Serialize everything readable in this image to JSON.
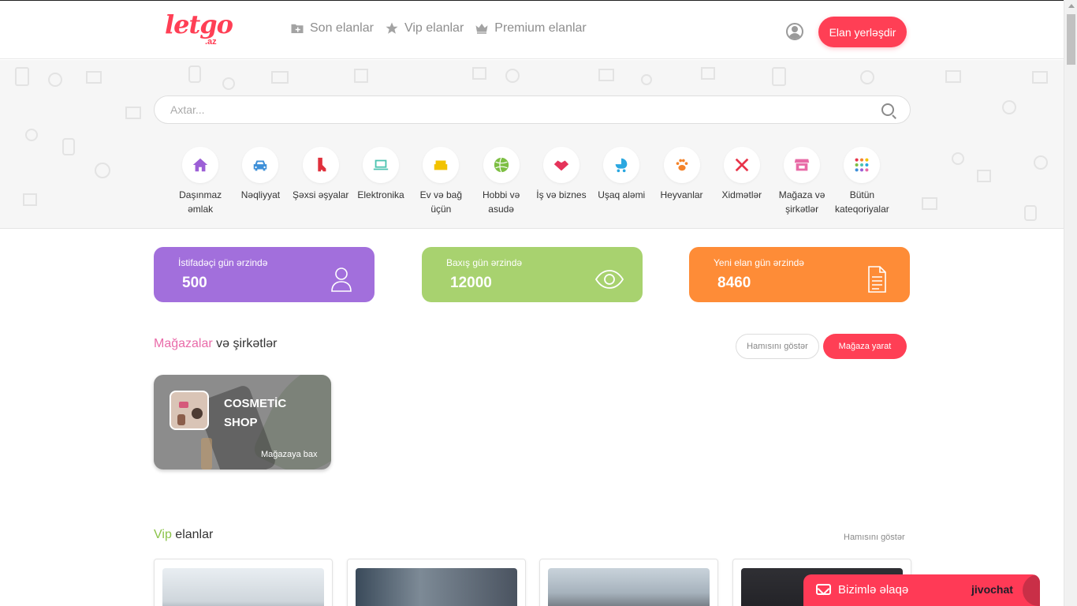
{
  "header": {
    "logo_text": "letgo",
    "logo_sub": ".az",
    "nav": [
      {
        "label": "Son elanlar",
        "icon": "folder-plus-icon"
      },
      {
        "label": "Vip elanlar",
        "icon": "star-icon"
      },
      {
        "label": "Premium elanlar",
        "icon": "crown-icon"
      }
    ],
    "post_button": "Elan yerləşdir"
  },
  "search": {
    "placeholder": "Axtar..."
  },
  "categories": [
    {
      "label": "Daşınmaz əmlak",
      "icon": "house-icon",
      "color": "#9c5fd6"
    },
    {
      "label": "Nəqliyyat",
      "icon": "car-icon",
      "color": "#3d8fd8"
    },
    {
      "label": "Şəxsi əşyalar",
      "icon": "boot-icon",
      "color": "#e0303c"
    },
    {
      "label": "Elektronika",
      "icon": "laptop-icon",
      "color": "#4cc3b0"
    },
    {
      "label": "Ev və bağ üçün",
      "icon": "sofa-icon",
      "color": "#f2c200"
    },
    {
      "label": "Hobbi və asudə",
      "icon": "ball-icon",
      "color": "#7dbf43"
    },
    {
      "label": "İş və biznes",
      "icon": "handshake-icon",
      "color": "#e5335a"
    },
    {
      "label": "Uşaq aləmi",
      "icon": "stroller-icon",
      "color": "#2aa7e0"
    },
    {
      "label": "Heyvanlar",
      "icon": "paw-icon",
      "color": "#f4832a"
    },
    {
      "label": "Xidmətlər",
      "icon": "tools-icon",
      "color": "#e8344a"
    },
    {
      "label": "Mağaza və şirkətlər",
      "icon": "store-icon",
      "color": "#e86aa6"
    },
    {
      "label": "Bütün kateqoriyalar",
      "icon": "grid-icon",
      "color": "#8c6be0"
    }
  ],
  "stats": [
    {
      "label": "İstifadəçi gün ərzində",
      "value": "500",
      "icon": "user-icon"
    },
    {
      "label": "Baxış gün ərzində",
      "value": "12000",
      "icon": "eye-icon"
    },
    {
      "label": "Yeni elan gün ərzində",
      "value": "8460",
      "icon": "document-icon"
    }
  ],
  "stores": {
    "title_accent": "Mağazalar",
    "title_rest": " və şirkətlər",
    "show_all": "Hamısını göstər",
    "create": "Mağaza yarat",
    "cards": [
      {
        "name": "COSMETİC SHOP",
        "cta": "Mağazaya bax"
      }
    ]
  },
  "vip": {
    "title_accent": "Vip",
    "title_rest": " elanlar",
    "show_all": "Hamısını göstər"
  },
  "chat": {
    "label": "Bizimlə əlaqə",
    "brand": "jivochat"
  },
  "colors": {
    "brand": "#ff3f55",
    "stat_purple": "#a26fdc",
    "stat_green": "#a8d26f",
    "stat_orange": "#fe8c37"
  }
}
